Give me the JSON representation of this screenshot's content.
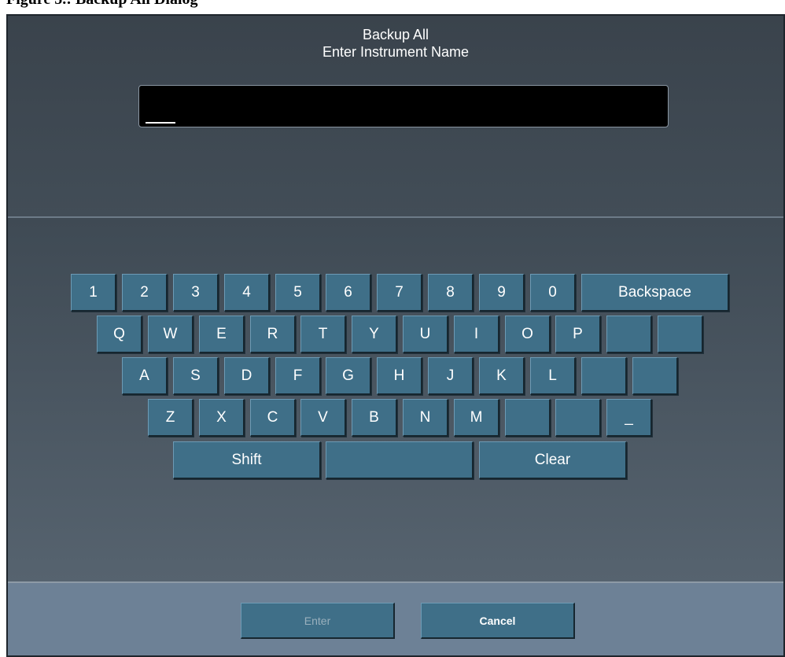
{
  "caption": "Figure 5.:  Backup All Dialog",
  "dialog": {
    "title": "Backup All",
    "subtitle": "Enter Instrument Name",
    "input_value": ""
  },
  "keyboard": {
    "row1": [
      "1",
      "2",
      "3",
      "4",
      "5",
      "6",
      "7",
      "8",
      "9",
      "0",
      "Backspace"
    ],
    "row2": [
      "Q",
      "W",
      "E",
      "R",
      "T",
      "Y",
      "U",
      "I",
      "O",
      "P",
      "",
      ""
    ],
    "row3": [
      "A",
      "S",
      "D",
      "F",
      "G",
      "H",
      "J",
      "K",
      "L",
      "",
      ""
    ],
    "row4": [
      "Z",
      "X",
      "C",
      "V",
      "B",
      "N",
      "M",
      "",
      "",
      "_"
    ],
    "row5": [
      "Shift",
      "",
      "Clear"
    ]
  },
  "buttons": {
    "enter_label": "Enter",
    "cancel_label": "Cancel",
    "enter_enabled": false
  }
}
